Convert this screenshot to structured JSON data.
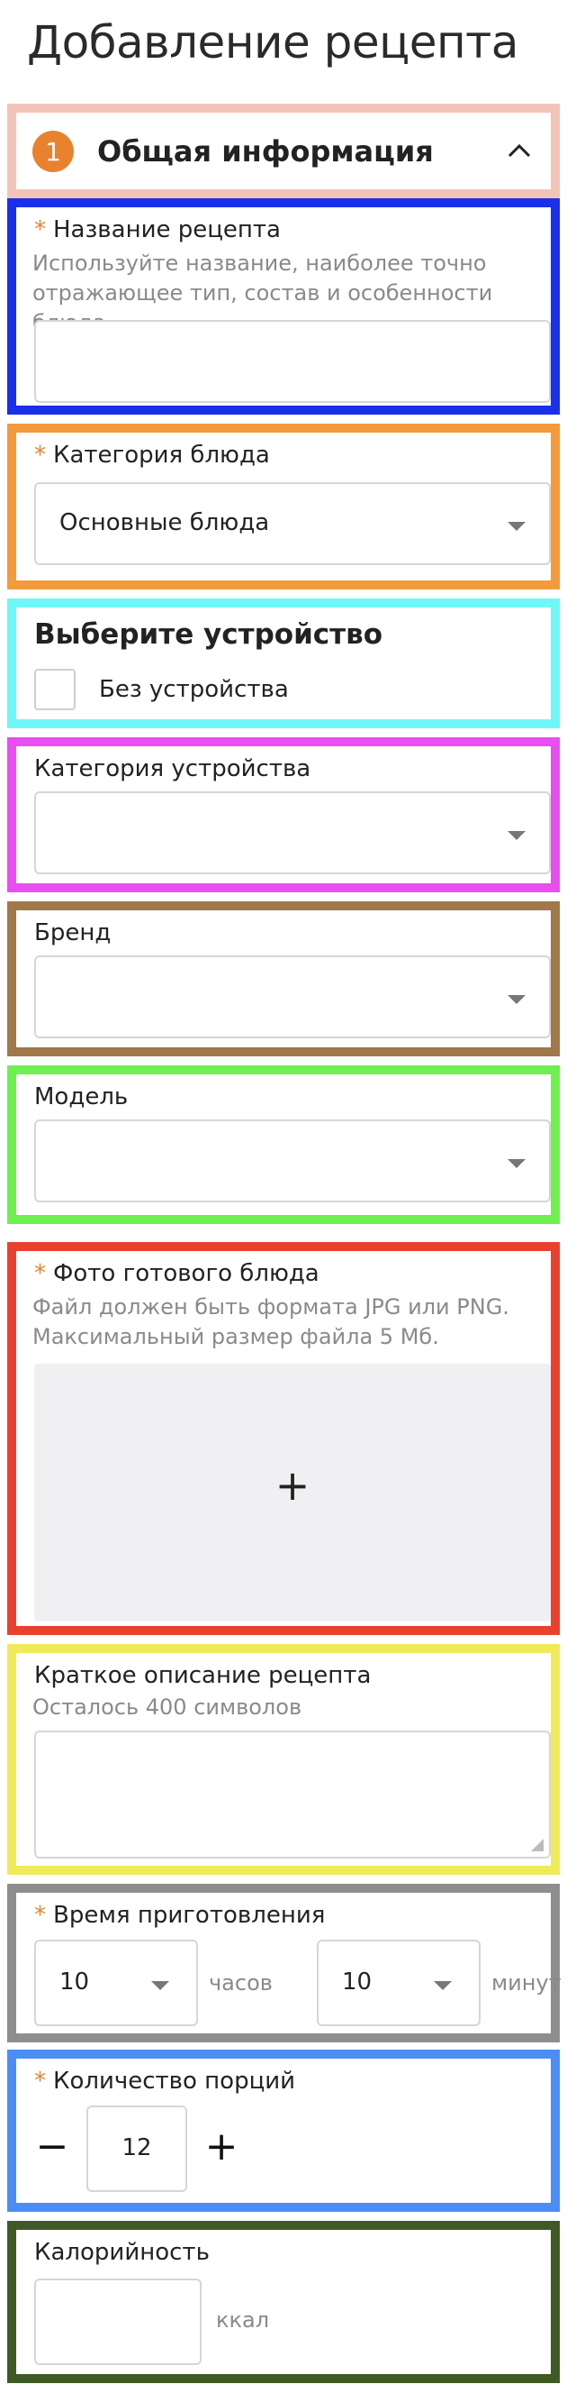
{
  "page_title": "Добавление рецепта",
  "section_info": {
    "number": "1",
    "label": "Общая информация"
  },
  "recipe_name": {
    "label": "Название рецепта",
    "hint": "Используйте название, наиболее точно отражающее тип, состав и особенности блюда",
    "value": ""
  },
  "dish_category": {
    "label": "Категория блюда",
    "value": "Основные блюда"
  },
  "device": {
    "heading": "Выберите устройство",
    "checkbox_label": "Без устройства",
    "checked": false
  },
  "device_category": {
    "label": "Категория устройства",
    "value": ""
  },
  "brand": {
    "label": "Бренд",
    "value": ""
  },
  "model": {
    "label": "Модель",
    "value": ""
  },
  "photo": {
    "label": "Фото готового блюда",
    "hint": "Файл должен быть формата JPG или PNG. Максимальный размер файла 5 Мб.",
    "add_symbol": "+"
  },
  "description": {
    "label": "Краткое описание рецепта",
    "hint": "Осталось 400 символов",
    "value": ""
  },
  "cook_time": {
    "label": "Время приготовления",
    "hours": "10",
    "hours_unit": "часов",
    "minutes": "10",
    "minutes_unit": "минут"
  },
  "servings": {
    "label": "Количество порций",
    "value": "12",
    "minus": "−",
    "plus": "+"
  },
  "calories": {
    "label": "Калорийность",
    "value": "",
    "unit": "ккал"
  },
  "colors": {
    "accent": "#e8822f",
    "sec_info": "#f2c4b8",
    "sec_name": "#1a2fe8",
    "sec_category": "#f39a3c",
    "sec_device": "#6ff7f7",
    "sec_device_cat": "#e84ef0",
    "sec_brand": "#a0784a",
    "sec_model": "#6ef04f",
    "sec_photo": "#e8422f",
    "sec_desc": "#f0ea5a",
    "sec_time": "#8e8e8e",
    "sec_servings": "#4a8ef5",
    "sec_calories": "#3f5a26"
  }
}
